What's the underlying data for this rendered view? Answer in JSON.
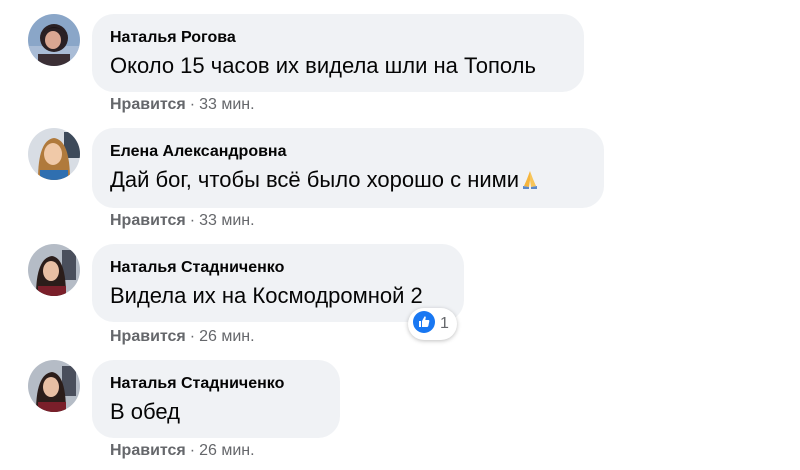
{
  "comments": [
    {
      "author": "Наталья Рогова",
      "text": "Около 15 часов их видела шли на Тополь",
      "like_label": "Нравится",
      "separator": "·",
      "time": "33 мин."
    },
    {
      "author": "Елена Александровна",
      "text": "Дай бог, чтобы всё было хорошо с ними",
      "emoji": "praying-hands-icon",
      "like_label": "Нравится",
      "separator": "·",
      "time": "33 мин."
    },
    {
      "author": "Наталья Стадниченко",
      "text": "Видела их на Космодромной 2",
      "reaction": {
        "icon": "thumbs-up-icon",
        "count": "1"
      },
      "like_label": "Нравится",
      "separator": "·",
      "time": "26 мин."
    },
    {
      "author": "Наталья Стадниченко",
      "text": "В обед",
      "like_label": "Нравится",
      "separator": "·",
      "time": "26 мин."
    }
  ],
  "colors": {
    "bubble": "#f0f2f5",
    "meta_text": "#65676b",
    "like_blue": "#1877f2"
  }
}
